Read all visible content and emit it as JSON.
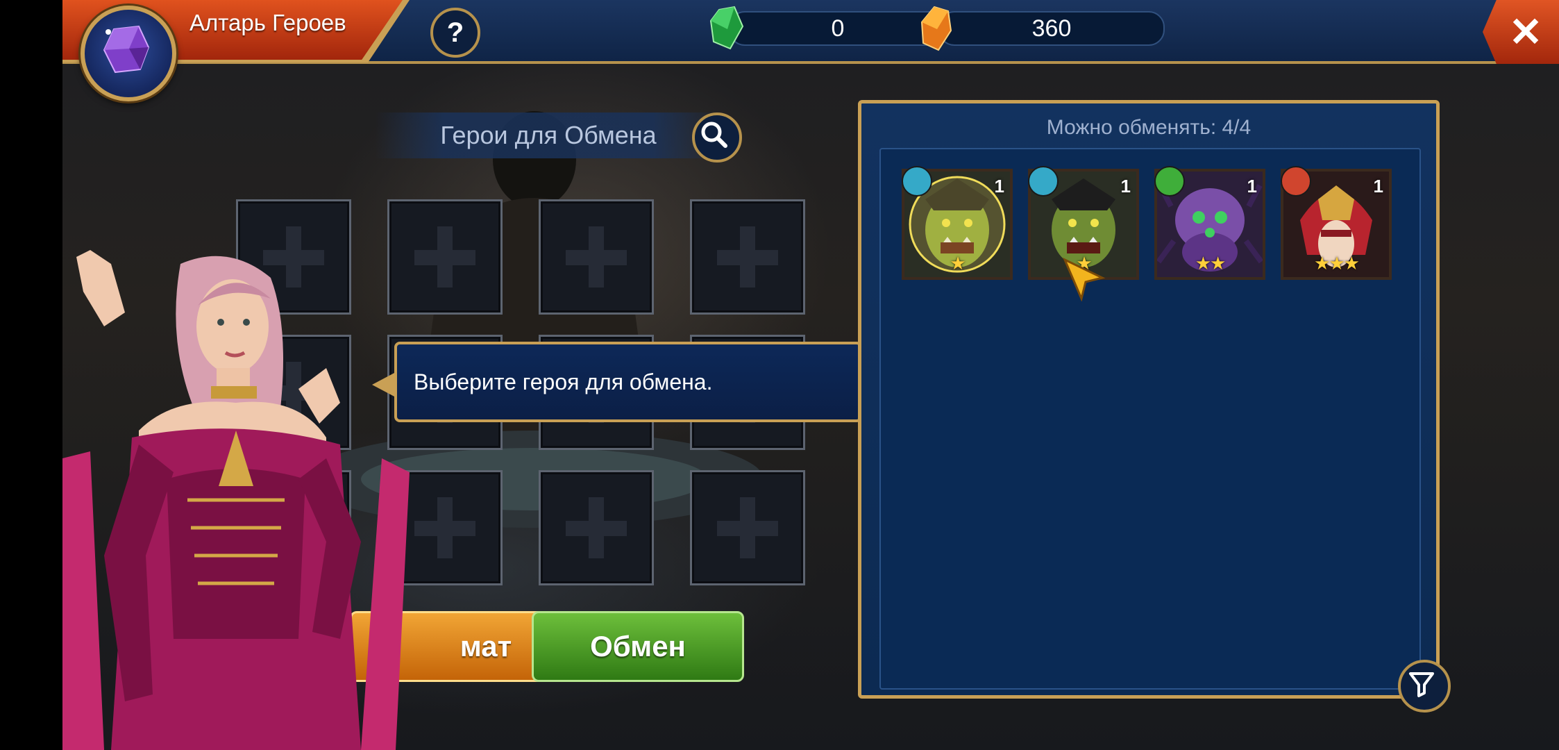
{
  "header": {
    "title": "Алтарь Героев",
    "help_label": "?",
    "close_label": "✕"
  },
  "resources": [
    {
      "icon": "green-gem-icon",
      "value": "0"
    },
    {
      "icon": "orange-shard-icon",
      "value": "360"
    }
  ],
  "exchange": {
    "title": "Герои для Обмена",
    "slots_count": 12,
    "tooltip": "Выберите героя для обмена.",
    "auto_button_label": "Автомат",
    "auto_button_visible": "мат",
    "exchange_button_label": "Обмен"
  },
  "hero_panel": {
    "available_label": "Можно обменять: 4/4",
    "heroes": [
      {
        "name": "orc-warrior",
        "level": "1",
        "stars": "★",
        "affinity": "magic",
        "affinity_color": "#35a9c8",
        "selected": true
      },
      {
        "name": "orc-warrior",
        "level": "1",
        "stars": "★",
        "affinity": "magic",
        "affinity_color": "#35a9c8",
        "selected": false
      },
      {
        "name": "purple-spider",
        "level": "1",
        "stars": "★★",
        "affinity": "nature",
        "affinity_color": "#3fae3a",
        "selected": false
      },
      {
        "name": "red-helmet-warrior",
        "level": "1",
        "stars": "★★★",
        "affinity": "force",
        "affinity_color": "#d0452e",
        "selected": false
      }
    ]
  },
  "colors": {
    "gold_border": "#c9a055",
    "panel_blue": "#0c2a52",
    "exchange_green": "#4e9d2a",
    "auto_orange": "#e0861e"
  }
}
